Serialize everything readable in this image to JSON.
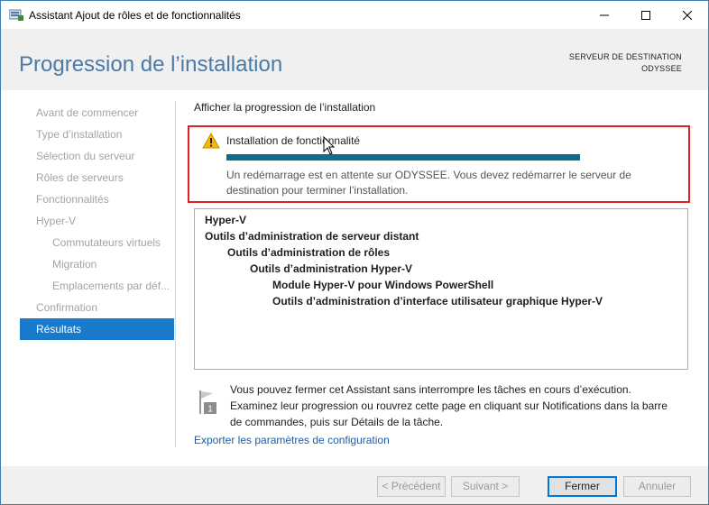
{
  "window": {
    "title": "Assistant Ajout de rôles et de fonctionnalités"
  },
  "header": {
    "page_title": "Progression de l’installation",
    "destination_label": "SERVEUR DE DESTINATION",
    "destination_server": "ODYSSEE"
  },
  "sidebar": {
    "items": [
      {
        "label": "Avant de commencer",
        "state": "disabled"
      },
      {
        "label": "Type d’installation",
        "state": "disabled"
      },
      {
        "label": "Sélection du serveur",
        "state": "disabled"
      },
      {
        "label": "Rôles de serveurs",
        "state": "disabled"
      },
      {
        "label": "Fonctionnalités",
        "state": "disabled"
      },
      {
        "label": "Hyper-V",
        "state": "disabled"
      },
      {
        "label": "Commutateurs virtuels",
        "state": "disabled"
      },
      {
        "label": "Migration",
        "state": "disabled"
      },
      {
        "label": "Emplacements par déf...",
        "state": "disabled"
      },
      {
        "label": "Confirmation",
        "state": "disabled"
      },
      {
        "label": "Résultats",
        "state": "active"
      }
    ]
  },
  "main": {
    "heading": "Afficher la progression de l’installation",
    "status": {
      "icon": "warning-icon",
      "title": "Installation de fonctionnalité",
      "progress_fraction": 1.0,
      "message": "Un redémarrage est en attente sur ODYSSEE. Vous devez redémarrer le serveur de destination pour terminer l’installation."
    },
    "features": [
      {
        "label": "Hyper-V",
        "level": 0
      },
      {
        "label": "Outils d’administration de serveur distant",
        "level": 0
      },
      {
        "label": "Outils d’administration de rôles",
        "level": 1
      },
      {
        "label": "Outils d’administration Hyper-V",
        "level": 2
      },
      {
        "label": "Module Hyper-V pour Windows PowerShell",
        "level": 3
      },
      {
        "label": "Outils d’administration d’interface utilisateur graphique Hyper-V",
        "level": 3
      }
    ],
    "note": "Vous pouvez fermer cet Assistant sans interrompre les tâches en cours d’exécution. Examinez leur progression ou rouvrez cette page en cliquant sur Notifications dans la barre de commandes, puis sur Détails de la tâche.",
    "note_badge": "1",
    "export_link": "Exporter les paramètres de configuration"
  },
  "footer": {
    "prev_label": "< Précédent",
    "next_label": "Suivant >",
    "close_label": "Fermer",
    "cancel_label": "Annuler"
  },
  "colors": {
    "accent": "#1979ca",
    "title_blue": "#4a7aa6",
    "progress": "#0e6c8c",
    "highlight_border": "#e02020"
  }
}
